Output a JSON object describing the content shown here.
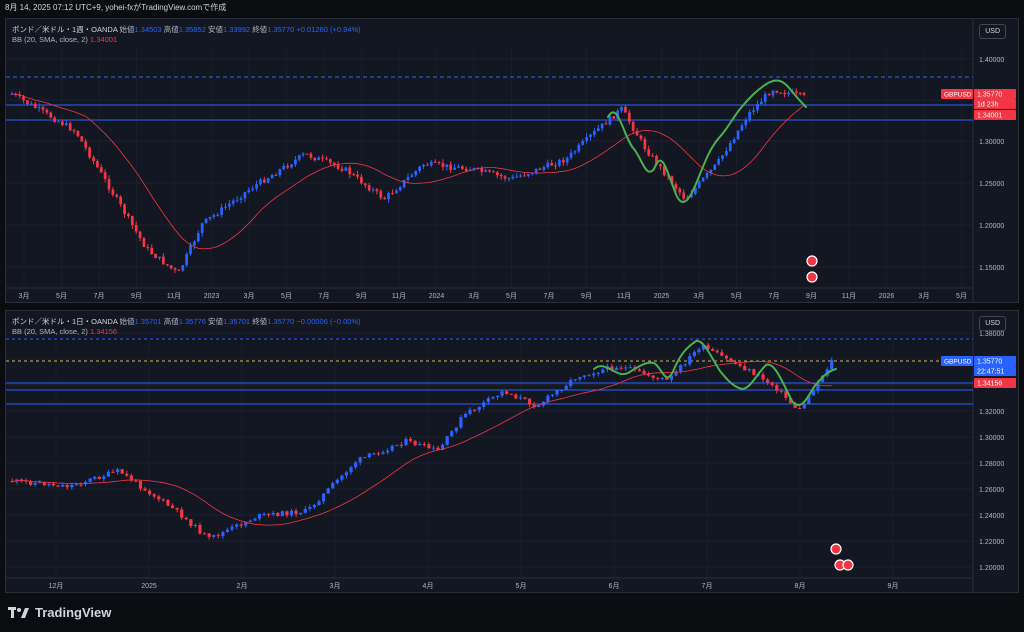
{
  "header": {
    "timestamp": "8月 14, 2025 07:12 UTC+9,  yohei-fxがTradingView.comで作成"
  },
  "charts": [
    {
      "ohlc": {
        "title": "ポンド／米ドル・1週・OANDA",
        "open_label": "始値",
        "open": "1.34503",
        "high_label": "高値",
        "high": "1.35852",
        "low_label": "安値",
        "low": "1.33992",
        "close_label": "終値",
        "close": "1.35770",
        "change": "+0.01260 (+0.94%)"
      },
      "indicator": {
        "name": "BB (20, SMA, close, 2)",
        "value": "1.34001"
      },
      "currency": "USD",
      "y_ticks": [
        "1.40000",
        "1.35000",
        "1.30000",
        "1.25000",
        "1.20000",
        "1.15000"
      ],
      "x_ticks": [
        "3月",
        "5月",
        "7月",
        "9月",
        "11月",
        "2023",
        "3月",
        "5月",
        "7月",
        "9月",
        "11月",
        "2024",
        "3月",
        "5月",
        "7月",
        "9月",
        "11月",
        "2025",
        "3月",
        "5月",
        "7月",
        "9月",
        "11月",
        "2026",
        "3月",
        "5月"
      ],
      "tags": {
        "symbol": "GBPUSD",
        "price": "1.35770",
        "countdown": "1d 23h",
        "bb": "1.34001"
      }
    },
    {
      "ohlc": {
        "title": "ポンド／米ドル・1日・OANDA",
        "open_label": "始値",
        "open": "1.35701",
        "high_label": "高値",
        "high": "1.35776",
        "low_label": "安値",
        "low": "1.35701",
        "close_label": "終値",
        "close": "1.35770",
        "change": "−0.00006 (−0.00%)"
      },
      "indicator": {
        "name": "BB (20, SMA, close, 2)",
        "value": "1.34156"
      },
      "currency": "USD",
      "y_ticks": [
        "1.38000",
        "1.36000",
        "1.34000",
        "1.32000",
        "1.30000",
        "1.28000",
        "1.26000",
        "1.24000",
        "1.22000",
        "1.20000"
      ],
      "x_ticks": [
        "12月",
        "2025",
        "2月",
        "3月",
        "4月",
        "5月",
        "6月",
        "7月",
        "8月",
        "9月"
      ],
      "tags": {
        "symbol": "GBPUSD",
        "price": "1.35770",
        "countdown": "22:47:51",
        "bb": "1.34156"
      }
    }
  ],
  "footer": {
    "brand": "TradingView"
  },
  "colors": {
    "bg": "#131722",
    "up": "#2962ff",
    "down": "#f23645",
    "bb": "#f23645",
    "wave": "#4caf50",
    "level": "#2962ff"
  }
}
